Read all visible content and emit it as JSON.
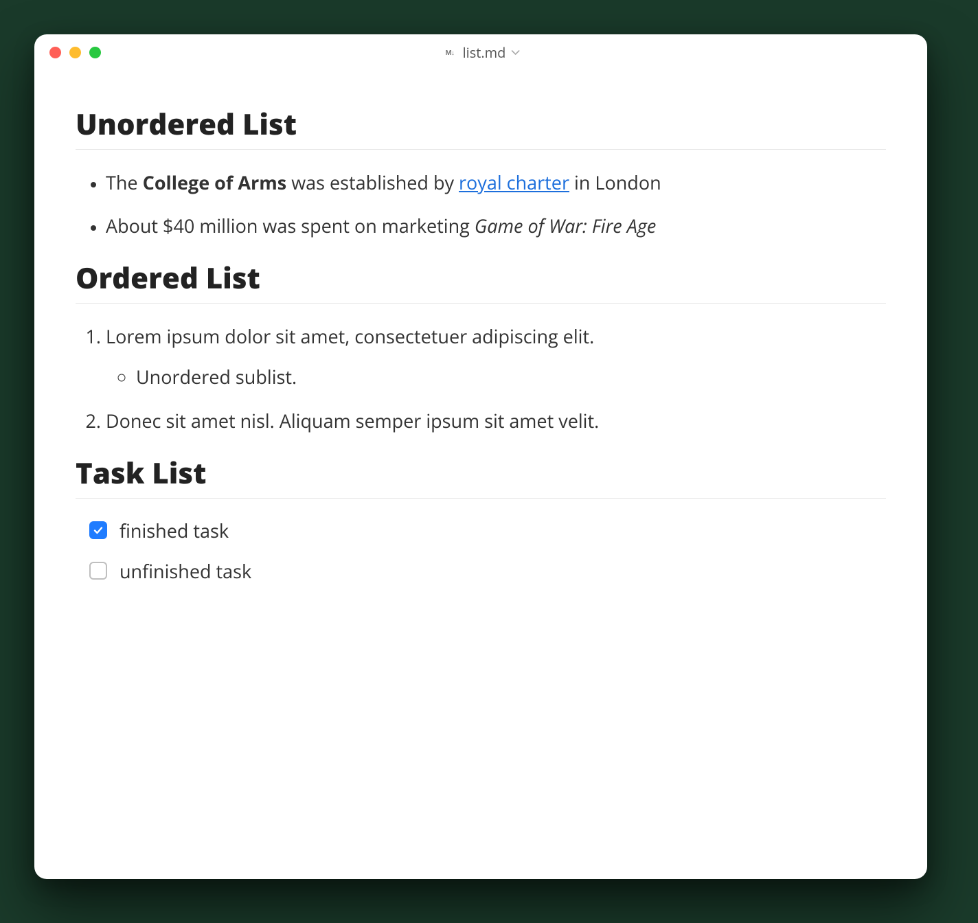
{
  "window": {
    "title": "list.md"
  },
  "sections": {
    "unordered": {
      "heading": "Unordered List",
      "items": [
        {
          "prefix": "The ",
          "bold": "College of Arms",
          "mid": " was established by ",
          "link": "royal charter",
          "suffix": " in London"
        },
        {
          "prefix": "About $40 million was spent on marketing ",
          "italic": "Game of War: Fire Age"
        }
      ]
    },
    "ordered": {
      "heading": "Ordered List",
      "items": [
        {
          "text": "Lorem ipsum dolor sit amet, consectetuer adipiscing elit.",
          "sublist": [
            "Unordered sublist."
          ]
        },
        {
          "text": "Donec sit amet nisl. Aliquam semper ipsum sit amet velit."
        }
      ]
    },
    "tasks": {
      "heading": "Task List",
      "items": [
        {
          "checked": true,
          "label": "finished task"
        },
        {
          "checked": false,
          "label": "unfinished task"
        }
      ]
    }
  }
}
